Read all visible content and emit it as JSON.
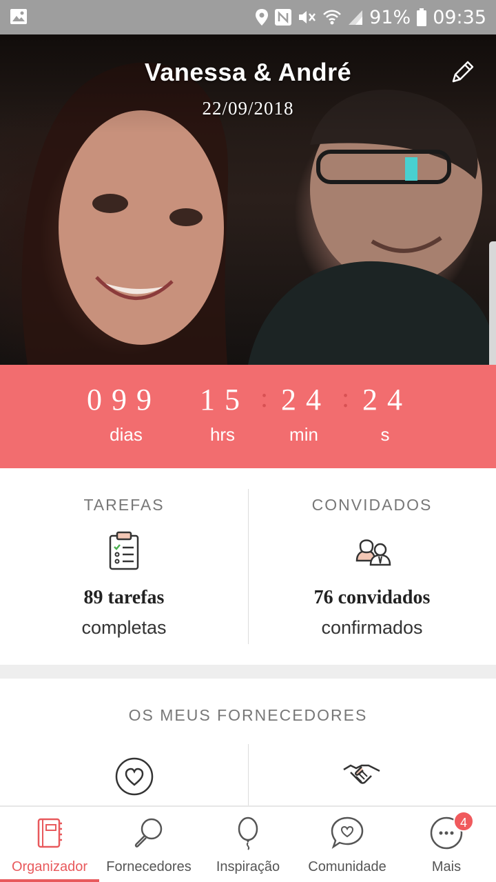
{
  "status_bar": {
    "battery": "91%",
    "time": "09:35",
    "icons": [
      "image-icon",
      "location-icon",
      "nfc-icon",
      "mute-icon",
      "wifi-icon",
      "signal-icon",
      "battery-icon"
    ]
  },
  "hero": {
    "title": "Vanessa & André",
    "date": "22/09/2018",
    "edit_icon": "pencil-icon"
  },
  "countdown": {
    "days": "099",
    "hours": "15",
    "minutes": "24",
    "seconds": "24",
    "days_label": "dias",
    "hours_label": "hrs",
    "minutes_label": "min",
    "seconds_label": "s"
  },
  "stats": {
    "tasks": {
      "title": "TAREFAS",
      "count": "89 tarefas",
      "sub": "completas",
      "icon": "clipboard-icon"
    },
    "guests": {
      "title": "CONVIDADOS",
      "count": "76 convidados",
      "sub": "confirmados",
      "icon": "guests-icon"
    }
  },
  "suppliers": {
    "title": "OS MEUS FORNECEDORES",
    "icons": [
      "heart-icon",
      "handshake-icon"
    ]
  },
  "bottom_nav": {
    "items": [
      {
        "label": "Organizador",
        "icon": "notebook-icon",
        "active": true
      },
      {
        "label": "Fornecedores",
        "icon": "magnifier-icon",
        "active": false
      },
      {
        "label": "Inspiração",
        "icon": "balloon-icon",
        "active": false
      },
      {
        "label": "Comunidade",
        "icon": "chat-heart-icon",
        "active": false
      },
      {
        "label": "Mais",
        "icon": "more-icon",
        "active": false,
        "badge": "4"
      }
    ]
  },
  "colors": {
    "accent": "#f26d6f",
    "active_nav": "#e8595c",
    "status_bar": "#9e9e9e"
  }
}
